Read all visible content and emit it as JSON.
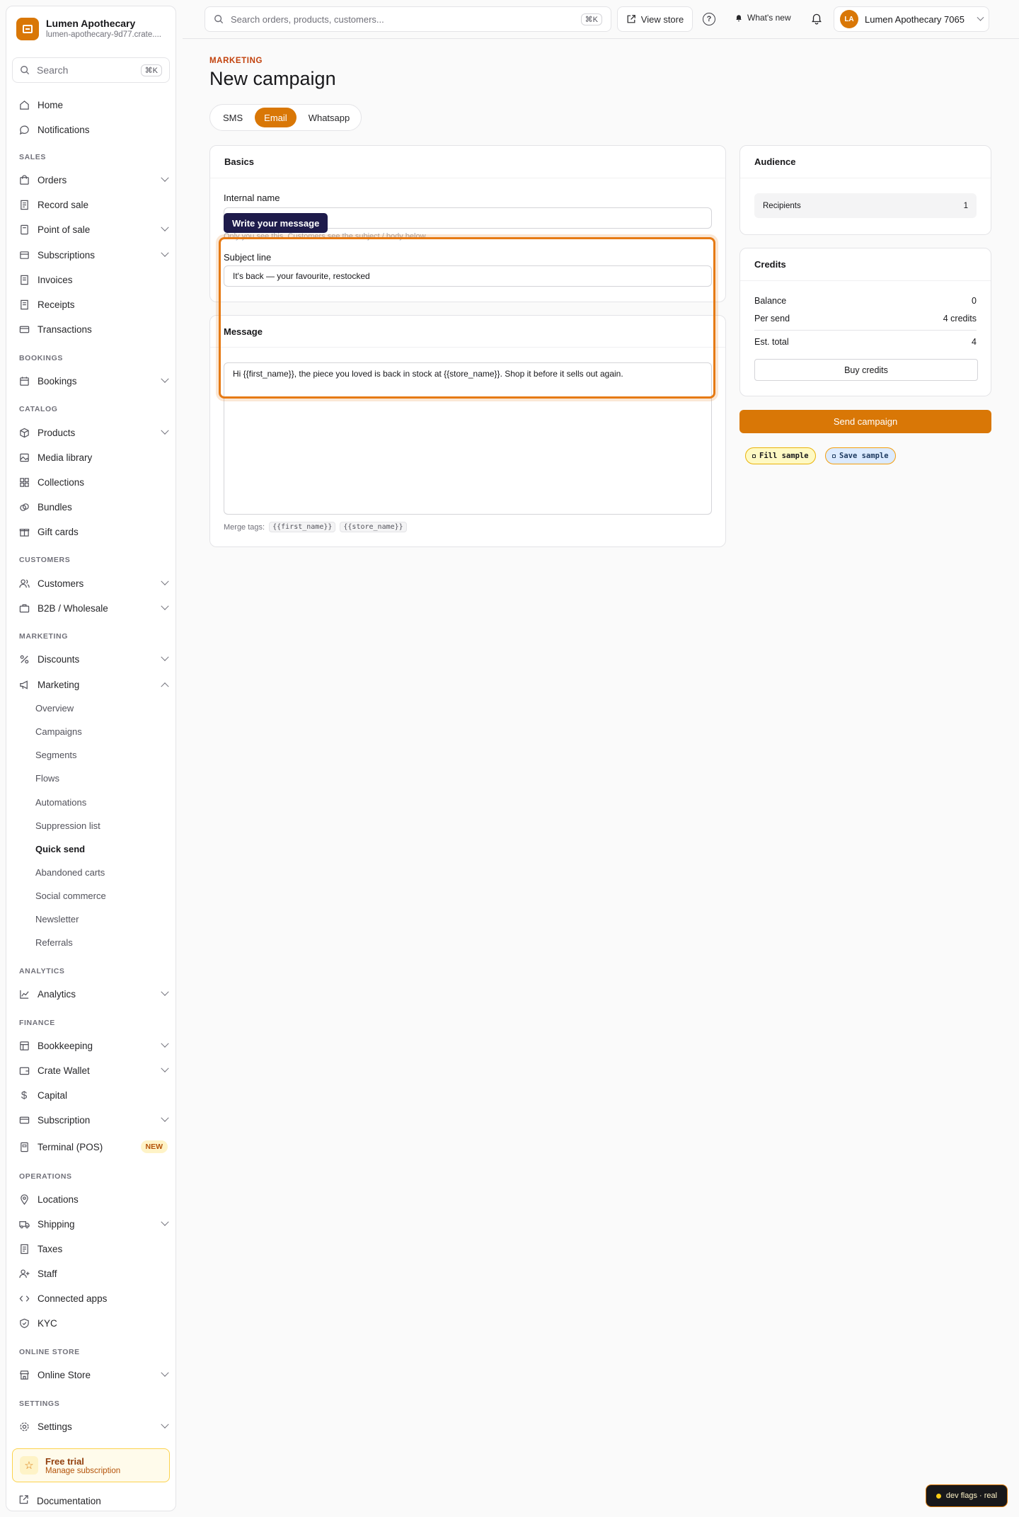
{
  "brand": {
    "name": "Lumen Apothecary",
    "subdomain": "lumen-apothecary-9d77.crate...."
  },
  "sidebar_search": {
    "placeholder": "Search",
    "shortcut": "⌘K"
  },
  "nav": {
    "home": "Home",
    "notifications": "Notifications",
    "sections": {
      "sales": "SALES",
      "bookings": "BOOKINGS",
      "catalog": "CATALOG",
      "customers": "CUSTOMERS",
      "marketing": "MARKETING",
      "analytics": "ANALYTICS",
      "finance": "FINANCE",
      "operations": "OPERATIONS",
      "online_store": "ONLINE STORE",
      "settings": "SETTINGS"
    },
    "orders": "Orders",
    "record_sale": "Record sale",
    "point_of_sale": "Point of sale",
    "subscriptions": "Subscriptions",
    "invoices": "Invoices",
    "receipts": "Receipts",
    "transactions": "Transactions",
    "bookings": "Bookings",
    "products": "Products",
    "media_library": "Media library",
    "collections": "Collections",
    "bundles": "Bundles",
    "gift_cards": "Gift cards",
    "customers": "Customers",
    "b2b": "B2B / Wholesale",
    "discounts": "Discounts",
    "marketing": "Marketing",
    "marketing_sub": [
      "Overview",
      "Campaigns",
      "Segments",
      "Flows",
      "Automations",
      "Suppression list",
      "Quick send",
      "Abandoned carts",
      "Social commerce",
      "Newsletter",
      "Referrals"
    ],
    "analytics": "Analytics",
    "bookkeeping": "Bookkeeping",
    "crate_wallet": "Crate Wallet",
    "capital": "Capital",
    "subscription": "Subscription",
    "terminal": "Terminal (POS)",
    "terminal_badge": "NEW",
    "locations": "Locations",
    "shipping": "Shipping",
    "taxes": "Taxes",
    "staff": "Staff",
    "connected_apps": "Connected apps",
    "kyc": "KYC",
    "online_store": "Online Store",
    "settings": "Settings"
  },
  "trial": {
    "title": "Free trial",
    "subtitle": "Manage subscription"
  },
  "documentation": "Documentation",
  "topbar": {
    "search_placeholder": "Search orders, products, customers...",
    "search_shortcut": "⌘K",
    "view_store": "View store",
    "help": "?",
    "whats_new": "What's new",
    "account_initials": "LA",
    "account_name": "Lumen Apothecary 7065"
  },
  "page": {
    "eyebrow": "MARKETING",
    "title": "New campaign",
    "channels": [
      "SMS",
      "Email",
      "Whatsapp"
    ],
    "active_channel": "Email"
  },
  "basics": {
    "heading": "Basics",
    "internal_name_label": "Internal name",
    "internal_name_value": "",
    "internal_name_hint": "Only you see this. Customers see the subject / body below.",
    "subject_label": "Subject line",
    "subject_value": "It's back — your favourite, restocked"
  },
  "message": {
    "heading": "Message",
    "body": "Hi {{first_name}}, the piece you loved is back in stock at {{store_name}}. Shop it before it sells out again.",
    "merge_label": "Merge tags:",
    "merge_tags": [
      "{{first_name}}",
      "{{store_name}}"
    ]
  },
  "tooltip": "Write your message",
  "audience": {
    "heading": "Audience",
    "recipients_label": "Recipients",
    "recipients_value": "1"
  },
  "credits": {
    "heading": "Credits",
    "balance_label": "Balance",
    "balance_value": "0",
    "per_send_label": "Per send",
    "per_send_value": "4 credits",
    "est_total_label": "Est. total",
    "est_total_value": "4",
    "buy_label": "Buy credits"
  },
  "send_campaign": "Send campaign",
  "dev_chips": {
    "fill": "Fill sample",
    "save": "Save sample"
  },
  "dev_flags": "dev flags · real",
  "colors": {
    "accent": "#d97706",
    "highlight": "#e67a14",
    "tooltip_bg": "#1e1b4b"
  }
}
